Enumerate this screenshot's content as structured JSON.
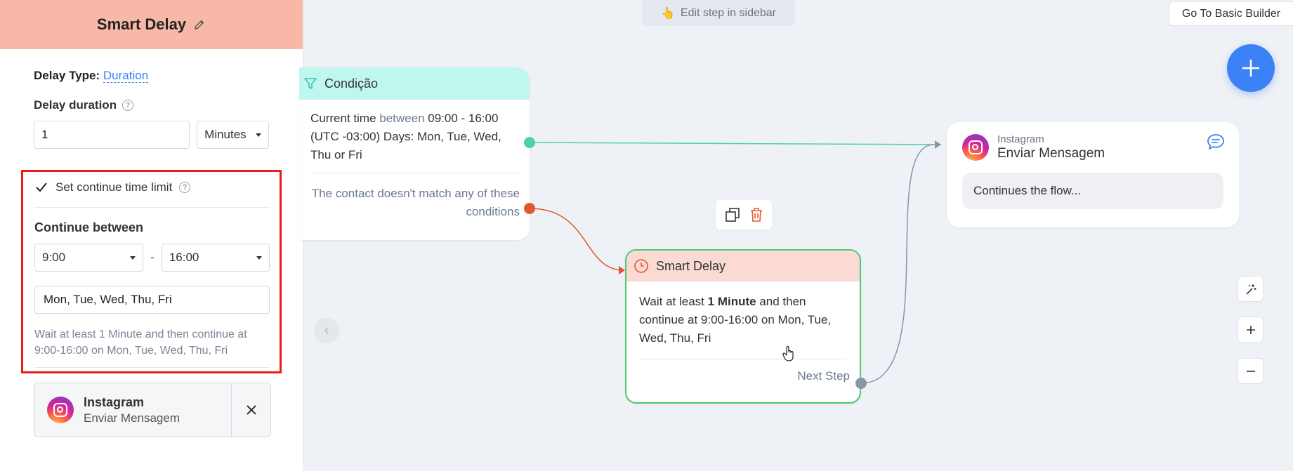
{
  "sidebar": {
    "title": "Smart Delay",
    "delay_type_label": "Delay Type:",
    "delay_type_value": "Duration",
    "delay_duration_label": "Delay duration",
    "help_glyph": "?",
    "duration_value": "1",
    "duration_unit": "Minutes",
    "continue_limit_label": "Set continue time limit",
    "continue_limit_checked": true,
    "continue_between_label": "Continue between",
    "time_from": "9:00",
    "time_separator": "-",
    "time_to": "16:00",
    "days": "Mon, Tue, Wed, Thu, Fri",
    "summary": "Wait at least 1 Minute  and then continue at 9:00-16:00 on Mon, Tue, Wed, Thu, Fri",
    "next_step": {
      "channel": "Instagram",
      "action": "Enviar Mensagem"
    }
  },
  "canvas": {
    "edit_hint_emoji": "👆",
    "edit_hint": "Edit step in sidebar",
    "basic_builder_button": "Go To Basic Builder",
    "condition_node": {
      "title": "Condição",
      "text_before": "Current time ",
      "text_highlight": "between",
      "text_after": " 09:00 - 16:00 (UTC -03:00) Days: Mon, Tue, Wed, Thu or Fri",
      "else_text": "The contact doesn't match any of these conditions"
    },
    "delay_node": {
      "title": "Smart Delay",
      "text_before": "Wait at least ",
      "text_bold": "1 Minute",
      "text_after": " and then continue at 9:00-16:00 on Mon, Tue, Wed, Thu, Fri",
      "next_step_label": "Next Step"
    },
    "instagram_node": {
      "channel": "Instagram",
      "title": "Enviar Mensagem",
      "message": "Continues the flow..."
    }
  },
  "colors": {
    "accent": "#3b82f6",
    "sidebar_header": "#f8b8a8",
    "condition_header": "#bff7ef",
    "delay_header": "#fbdad4",
    "delay_border": "#4ccb72",
    "highlight_box": "#e41e1e",
    "port_green": "#4fd1a5",
    "port_red": "#e4572e",
    "port_gray": "#8b93a7"
  },
  "icons": [
    "pencil-icon",
    "help-icon",
    "checkbox-icon",
    "instagram-icon",
    "close-icon",
    "filter-icon",
    "clock-icon",
    "copy-icon",
    "trash-icon",
    "chat-icon",
    "plus-icon",
    "magic-wand-icon",
    "zoom-in-icon",
    "zoom-out-icon",
    "chevron-left-icon",
    "pointer-hand-icon"
  ]
}
